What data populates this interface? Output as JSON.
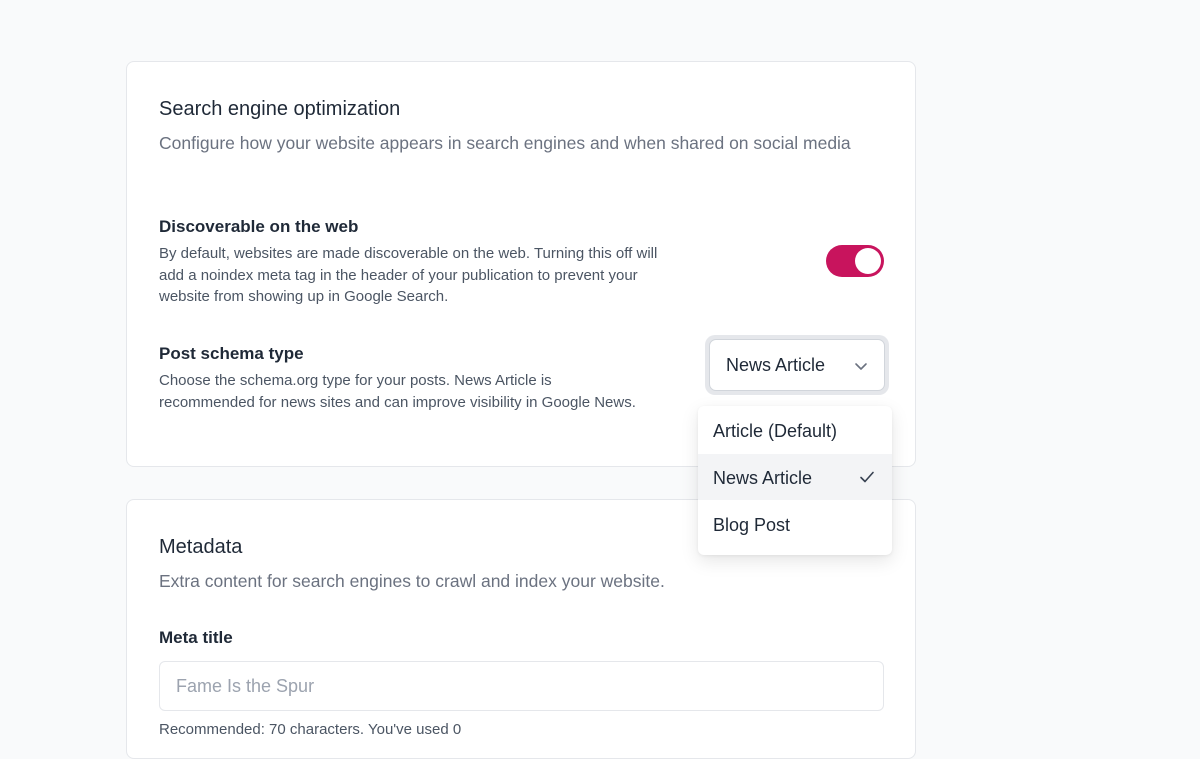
{
  "seo": {
    "title": "Search engine optimization",
    "description": "Configure how your website appears in search engines and when shared on social media",
    "discoverable": {
      "title": "Discoverable on the web",
      "description": "By default, websites are made discoverable on the web. Turning this off will add a noindex meta tag in the header of your publication to prevent your website from showing up in Google Search.",
      "enabled": true
    },
    "schema": {
      "title": "Post schema type",
      "description": "Choose the schema.org type for your posts. News Article is recommended for news sites and can improve visibility in Google News.",
      "selected": "News Article",
      "options": [
        "Article (Default)",
        "News Article",
        "Blog Post"
      ]
    }
  },
  "metadata": {
    "title": "Metadata",
    "description": "Extra content for search engines to crawl and index your website.",
    "meta_title_label": "Meta title",
    "meta_title_placeholder": "Fame Is the Spur",
    "meta_title_hint": "Recommended: 70 characters. You've used 0"
  },
  "colors": {
    "accent": "#c8145d",
    "page_bg": "#f9fafb",
    "muted_text": "#6b7280"
  },
  "icons": {
    "select_chevron": "chevron-down-icon",
    "selected_check": "check-icon"
  }
}
